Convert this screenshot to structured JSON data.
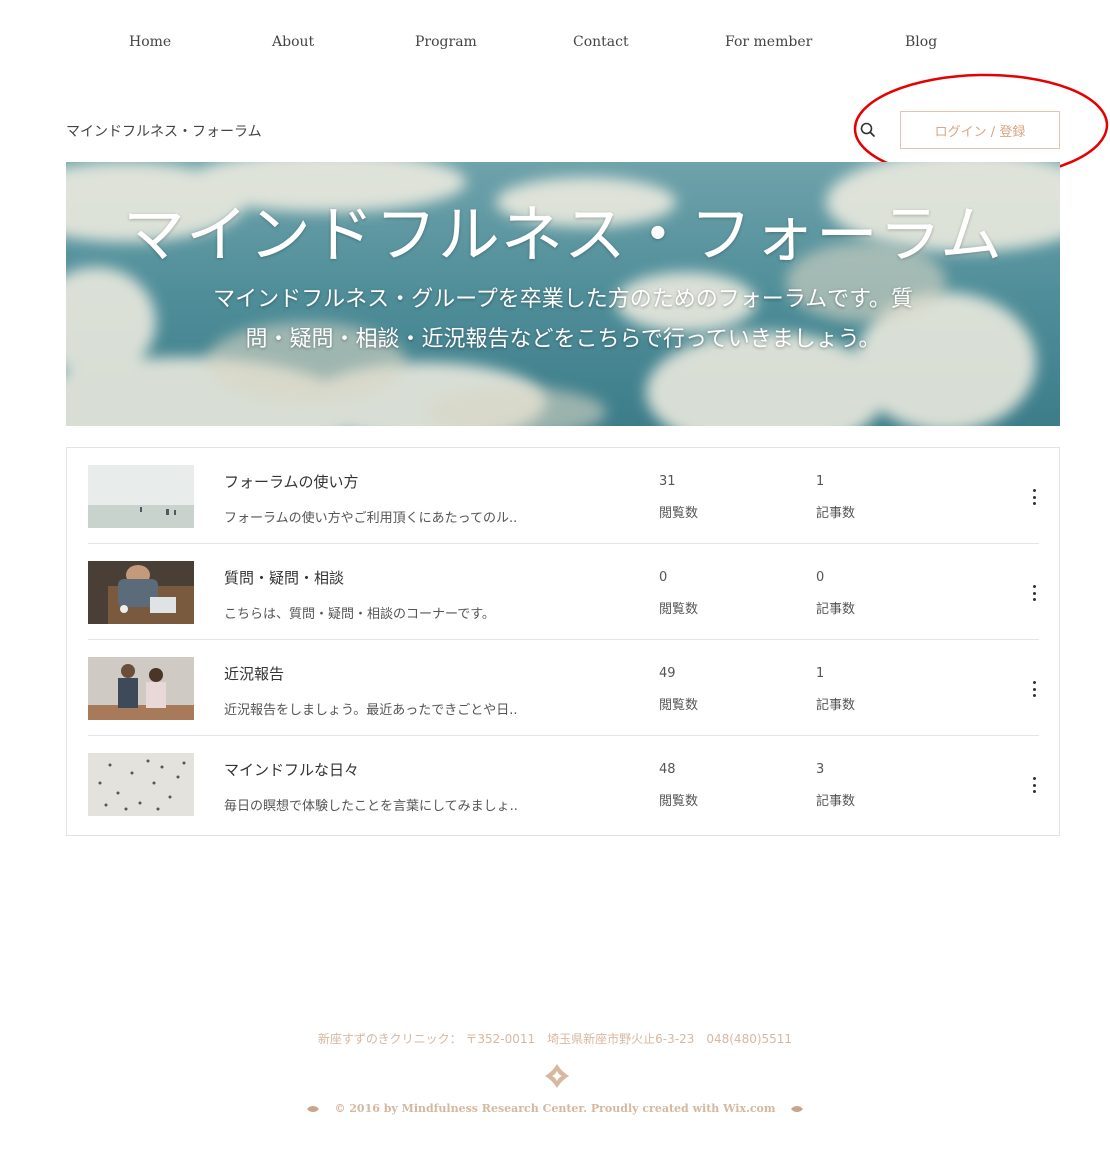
{
  "nav": {
    "items": [
      "Home",
      "About",
      "Program",
      "Contact",
      "For member",
      "Blog"
    ]
  },
  "forum": {
    "breadcrumb": "マインドフルネス・フォーラム",
    "login_label": "ログイン / 登録"
  },
  "hero": {
    "title": "マインドフルネス・フォーラム",
    "subtitle": "マインドフルネス・グループを卒業した方のためのフォーラムです。質問・疑問・相談・近況報告などをこちらで行っていきましょう。"
  },
  "categories": [
    {
      "title": "フォーラムの使い方",
      "desc": "フォーラムの使い方やご利用頂くにあたってのル..",
      "views": "31",
      "views_label": "閲覧数",
      "posts": "1",
      "posts_label": "記事数"
    },
    {
      "title": "質問・疑問・相談",
      "desc": "こちらは、質問・疑問・相談のコーナーです。",
      "views": "0",
      "views_label": "閲覧数",
      "posts": "0",
      "posts_label": "記事数"
    },
    {
      "title": "近況報告",
      "desc": "近況報告をしましょう。最近あったできごとや日..",
      "views": "49",
      "views_label": "閲覧数",
      "posts": "1",
      "posts_label": "記事数"
    },
    {
      "title": "マインドフルな日々",
      "desc": "毎日の瞑想で体験したことを言葉にしてみましょ..",
      "views": "48",
      "views_label": "閲覧数",
      "posts": "3",
      "posts_label": "記事数"
    }
  ],
  "footer": {
    "address": "新座すずのきクリニック： 〒352-0011　埼玉県新座市野火止6-3-23　048(480)5511",
    "copyright": "© 2016 by Mindfulness Research Center. Proudly created with Wix.com"
  },
  "colors": {
    "accent": "#d9a683",
    "annotation": "#e60000"
  },
  "icons": {
    "search": "search-icon",
    "more": "more-vertical-icon",
    "footer_logo": "diamond-logo-icon"
  }
}
